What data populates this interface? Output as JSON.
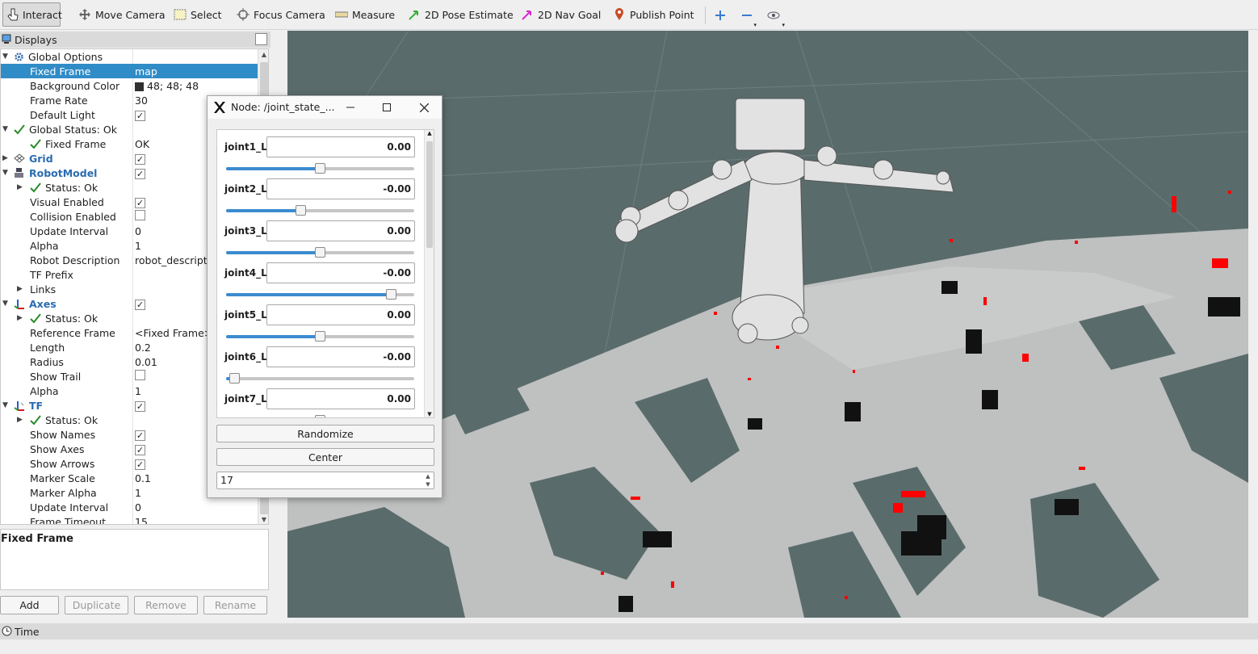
{
  "toolbar": {
    "tools": [
      {
        "label": "Interact",
        "icon": "cursor-hand-icon"
      },
      {
        "label": "Move Camera",
        "icon": "move-camera-icon"
      },
      {
        "label": "Select",
        "icon": "select-box-icon"
      },
      {
        "label": "Focus Camera",
        "icon": "focus-camera-icon"
      },
      {
        "label": "Measure",
        "icon": "ruler-icon"
      },
      {
        "label": "2D Pose Estimate",
        "icon": "green-arrow-icon"
      },
      {
        "label": "2D Nav Goal",
        "icon": "magenta-arrow-icon"
      },
      {
        "label": "Publish Point",
        "icon": "map-pin-icon"
      }
    ],
    "extra_icons": [
      "plus-icon",
      "minus-icon",
      "eye-icon"
    ]
  },
  "displays": {
    "title": "Displays",
    "rows": [
      {
        "name": "Global Options",
        "value": "",
        "indent": 0,
        "expander": "open",
        "icon": "gear-icon",
        "style": "plain"
      },
      {
        "name": "Fixed Frame",
        "value": "map",
        "indent": 1,
        "selected": true
      },
      {
        "name": "Background Color",
        "value": "48; 48; 48",
        "indent": 1,
        "swatch": "#303030"
      },
      {
        "name": "Frame Rate",
        "value": "30",
        "indent": 1
      },
      {
        "name": "Default Light",
        "value": "",
        "indent": 1,
        "check": true
      },
      {
        "name": "Global Status: Ok",
        "value": "",
        "indent": 0,
        "expander": "open",
        "icon": "check-icon"
      },
      {
        "name": "Fixed Frame",
        "value": "OK",
        "indent": 1,
        "icon": "check-icon"
      },
      {
        "name": "Grid",
        "value": "",
        "indent": 0,
        "expander": "closed",
        "icon": "grid-icon",
        "style": "blue",
        "check": true
      },
      {
        "name": "RobotModel",
        "value": "",
        "indent": 0,
        "expander": "open",
        "icon": "robot-icon",
        "style": "blue",
        "check": true
      },
      {
        "name": "Status: Ok",
        "value": "",
        "indent": 1,
        "expander": "closed",
        "icon": "check-icon"
      },
      {
        "name": "Visual Enabled",
        "value": "",
        "indent": 1,
        "check": true
      },
      {
        "name": "Collision Enabled",
        "value": "",
        "indent": 1,
        "check": false
      },
      {
        "name": "Update Interval",
        "value": "0",
        "indent": 1
      },
      {
        "name": "Alpha",
        "value": "1",
        "indent": 1
      },
      {
        "name": "Robot Description",
        "value": "robot_descripti",
        "indent": 1
      },
      {
        "name": "TF Prefix",
        "value": "",
        "indent": 1
      },
      {
        "name": "Links",
        "value": "",
        "indent": 1,
        "expander": "closed"
      },
      {
        "name": "Axes",
        "value": "",
        "indent": 0,
        "expander": "open",
        "icon": "axes-icon",
        "style": "blue",
        "check": true
      },
      {
        "name": "Status: Ok",
        "value": "",
        "indent": 1,
        "expander": "closed",
        "icon": "check-icon"
      },
      {
        "name": "Reference Frame",
        "value": "<Fixed Frame>",
        "indent": 1
      },
      {
        "name": "Length",
        "value": "0.2",
        "indent": 1
      },
      {
        "name": "Radius",
        "value": "0.01",
        "indent": 1
      },
      {
        "name": "Show Trail",
        "value": "",
        "indent": 1,
        "check": false
      },
      {
        "name": "Alpha",
        "value": "1",
        "indent": 1
      },
      {
        "name": "TF",
        "value": "",
        "indent": 0,
        "expander": "open",
        "icon": "tf-icon",
        "style": "blue",
        "check": true
      },
      {
        "name": "Status: Ok",
        "value": "",
        "indent": 1,
        "expander": "closed",
        "icon": "check-icon"
      },
      {
        "name": "Show Names",
        "value": "",
        "indent": 1,
        "check": true
      },
      {
        "name": "Show Axes",
        "value": "",
        "indent": 1,
        "check": true
      },
      {
        "name": "Show Arrows",
        "value": "",
        "indent": 1,
        "check": true
      },
      {
        "name": "Marker Scale",
        "value": "0.1",
        "indent": 1
      },
      {
        "name": "Marker Alpha",
        "value": "1",
        "indent": 1
      },
      {
        "name": "Update Interval",
        "value": "0",
        "indent": 1
      },
      {
        "name": "Frame Timeout",
        "value": "15",
        "indent": 1
      }
    ],
    "description_title": "Fixed Frame",
    "buttons": [
      {
        "label": "Add",
        "enabled": true
      },
      {
        "label": "Duplicate",
        "enabled": false
      },
      {
        "label": "Remove",
        "enabled": false
      },
      {
        "label": "Rename",
        "enabled": false
      }
    ]
  },
  "joint_dialog": {
    "title": "Node: /joint_state_...",
    "joints": [
      {
        "name": "joint1_L",
        "value": "0.00",
        "slider": 0.5
      },
      {
        "name": "joint2_L",
        "value": "-0.00",
        "slider": 0.39
      },
      {
        "name": "joint3_L",
        "value": "0.00",
        "slider": 0.5
      },
      {
        "name": "joint4_L",
        "value": "-0.00",
        "slider": 0.9
      },
      {
        "name": "joint5_L",
        "value": "0.00",
        "slider": 0.5
      },
      {
        "name": "joint6_L",
        "value": "-0.00",
        "slider": 0.02
      },
      {
        "name": "joint7_L",
        "value": "0.00",
        "slider": 0.5
      }
    ],
    "randomize_label": "Randomize",
    "center_label": "Center",
    "spin_value": "17"
  },
  "time_panel": {
    "title": "Time"
  },
  "colors": {
    "accent": "#308cc6",
    "background": "#303030",
    "viewport_floor": "#5a6b6b"
  }
}
